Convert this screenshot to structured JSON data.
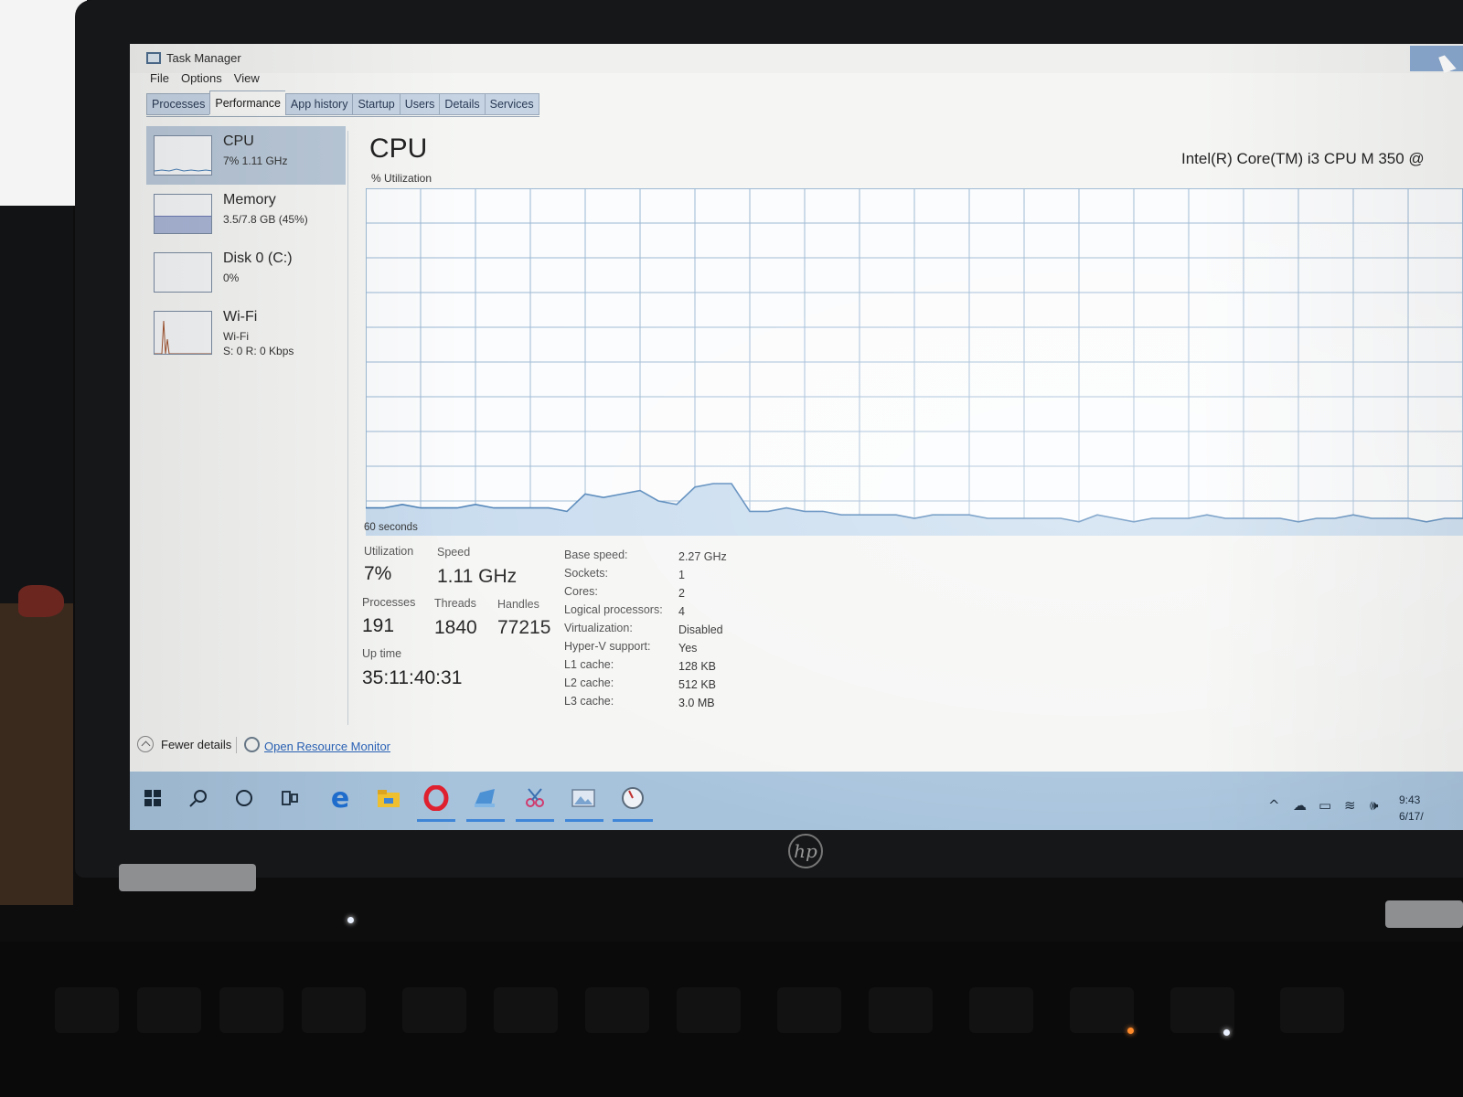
{
  "window": {
    "title": "Task Manager",
    "menu": [
      "File",
      "Options",
      "View"
    ],
    "tabs": [
      "Processes",
      "Performance",
      "App history",
      "Startup",
      "Users",
      "Details",
      "Services"
    ],
    "active_tab": "Performance"
  },
  "sidebar": {
    "items": [
      {
        "name": "CPU",
        "detail": "7% 1.11 GHz",
        "active": true
      },
      {
        "name": "Memory",
        "detail": "3.5/7.8 GB (45%)",
        "active": false
      },
      {
        "name": "Disk 0 (C:)",
        "detail": "0%",
        "active": false
      },
      {
        "name": "Wi-Fi",
        "detail": "Wi-Fi",
        "detail2": "S: 0 R: 0 Kbps",
        "active": false
      }
    ]
  },
  "main": {
    "title": "CPU",
    "cpu_model": "Intel(R) Core(TM) i3 CPU M 350 @",
    "graph_label": "% Utilization",
    "time_label": "60 seconds",
    "utilization_label": "Utilization",
    "utilization": "7%",
    "speed_label": "Speed",
    "speed": "1.11 GHz",
    "processes_label": "Processes",
    "processes": "191",
    "threads_label": "Threads",
    "threads": "1840",
    "handles_label": "Handles",
    "handles": "77215",
    "uptime_label": "Up time",
    "uptime": "35:11:40:31",
    "specs": [
      {
        "label": "Base speed:",
        "value": "2.27 GHz"
      },
      {
        "label": "Sockets:",
        "value": "1"
      },
      {
        "label": "Cores:",
        "value": "2"
      },
      {
        "label": "Logical processors:",
        "value": "4"
      },
      {
        "label": "Virtualization:",
        "value": "Disabled"
      },
      {
        "label": "Hyper-V support:",
        "value": "Yes"
      },
      {
        "label": "L1 cache:",
        "value": "128 KB"
      },
      {
        "label": "L2 cache:",
        "value": "512 KB"
      },
      {
        "label": "L3 cache:",
        "value": "3.0 MB"
      }
    ]
  },
  "cpu_history_percent": [
    8,
    8,
    9,
    8,
    8,
    8,
    9,
    8,
    8,
    8,
    8,
    7,
    12,
    11,
    12,
    13,
    10,
    9,
    14,
    15,
    15,
    7,
    7,
    8,
    7,
    7,
    6,
    6,
    6,
    6,
    5,
    6,
    6,
    6,
    5,
    5,
    5,
    5,
    5,
    4,
    6,
    5,
    4,
    5,
    5,
    5,
    6,
    5,
    5,
    5,
    5,
    4,
    5,
    5,
    6,
    5,
    5,
    5,
    4,
    5,
    5
  ],
  "footer": {
    "fewer_details": "Fewer details",
    "open_resource_monitor": "Open Resource Monitor"
  },
  "taskbar": {
    "icons": [
      "windows-start-icon",
      "search-icon",
      "cortana-icon",
      "task-view-icon",
      "edge-icon",
      "file-explorer-icon",
      "opera-icon",
      "app-icon",
      "snipping-tool-icon",
      "photos-icon",
      "task-manager-icon"
    ],
    "clock_time": "9:43",
    "clock_date": "6/17/"
  },
  "laptop": {
    "brand": "hp"
  },
  "colors": {
    "graph_line": "#4a7fb5",
    "graph_fill": "#c7dbee",
    "grid": "#9ab7d3",
    "taskbar": "#a7c3dc",
    "selected_item": "#b9c8d8",
    "link": "#2b63b8"
  }
}
